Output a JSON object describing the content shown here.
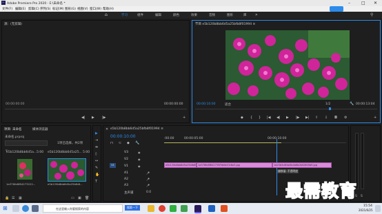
{
  "window": {
    "title": "Adobe Premiere Pro 2020 - E:\\未命名 *"
  },
  "menu": [
    "文件(F)",
    "编辑(E)",
    "剪辑(C)",
    "序列(S)",
    "标记(M)",
    "图形(G)",
    "视图(V)",
    "窗口(W)",
    "帮助(H)"
  ],
  "workspaces": [
    "学习",
    "组件",
    "编辑",
    "颜色",
    "效果",
    "音频",
    "图形",
    "库"
  ],
  "source_panel": {
    "tab": "源：(无剪辑)",
    "timecode_left": "00:00:00:00",
    "timecode_right": "00:00:00:00"
  },
  "program_panel": {
    "tab": "节目 e5b120b8bb6d5a25bfb8f01994 ≡",
    "timecode_left": "00:00:10:00",
    "fit": "适合",
    "ratio": "1/2",
    "timecode_right": "00:00:13:04"
  },
  "project_panel": {
    "tabs": [
      "项目: 未命名",
      "媒体浏览器"
    ],
    "file": "未命名.prproj",
    "count": "1项已选择，共2项",
    "items": [
      {
        "name": "e5b120b8bb6d5a...",
        "dur": "5:00"
      },
      {
        "name": "e5b120b8bb6d5a25...",
        "dur": "5:00"
      }
    ],
    "thumb_captions": [
      "1a376fe8f84273222...",
      "e5b120b8bb6d5a25bfb8..."
    ]
  },
  "timeline": {
    "tab": "e5b120b8bb6d5a25bfb8f01994 ≡",
    "timecode": "00:00:10:00",
    "ruler": [
      ":00:00",
      "00:00:05:00",
      "00:00:10:00"
    ],
    "tracks": [
      "V3",
      "V2",
      "V1",
      "A1",
      "A2",
      "A3",
      "主声道"
    ],
    "clips": [
      "e5b120b8bb6d5a25bfb8f01994.jpg",
      "1a376fe8f842735f9b0d43c6a3.jpg",
      "1a25b3c8fda5b4b6b0b52800b9.jpg"
    ],
    "tooltip": "偏移量: 不透明度",
    "master_value": "0.0"
  },
  "taskbar": {
    "search": "在这里输入你要搜索的内容",
    "ime": "搜索一下",
    "time": "15:54",
    "date": "2021/6/25"
  },
  "watermark": "最需教育",
  "colors": {
    "accent": "#2d8ceb",
    "clip": "#d98ad9",
    "playhead": "#2d8ceb"
  }
}
